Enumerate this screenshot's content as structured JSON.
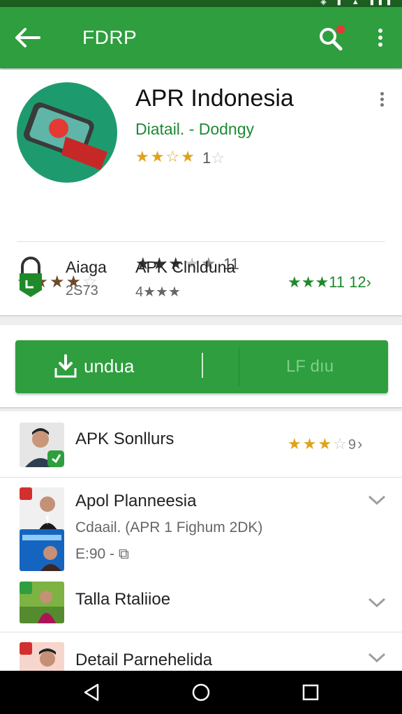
{
  "app_bar": {
    "title": "FDRP",
    "back_icon": "arrow-left-icon",
    "search_icon": "search-icon",
    "more_icon": "more-vert-icon"
  },
  "app": {
    "name": "APR Indonesia",
    "subtitle": "Diatail. - Dodngy",
    "rating_top_count": "1",
    "rating_mid_count": "11",
    "rating_mid_stars": 3,
    "rating_top_stars": 4,
    "rating_left_stars": 4
  },
  "info": {
    "item1_label": "Aiaga",
    "item1_sub": "2S73",
    "item2_label": "APK Clnlduna",
    "item2_sub": "4★★★",
    "rating_text": "11  12"
  },
  "install": {
    "label": "undua",
    "secondary_label": "LF dıu"
  },
  "list": [
    {
      "title": "APK Sonllurs",
      "rating_suffix": "9"
    },
    {
      "title": "Apol Planneesia",
      "subtitle": "Cdaail. (APR 1 Fighum 2DK)",
      "price": "E:90 -"
    },
    {
      "title": "Talla Rtaliioe"
    },
    {
      "title": "Detail Parnehelida"
    }
  ],
  "colors": {
    "primary": "#2e9e3e",
    "primary_dark": "#1b5e20",
    "star_gold": "#e0a21a"
  }
}
